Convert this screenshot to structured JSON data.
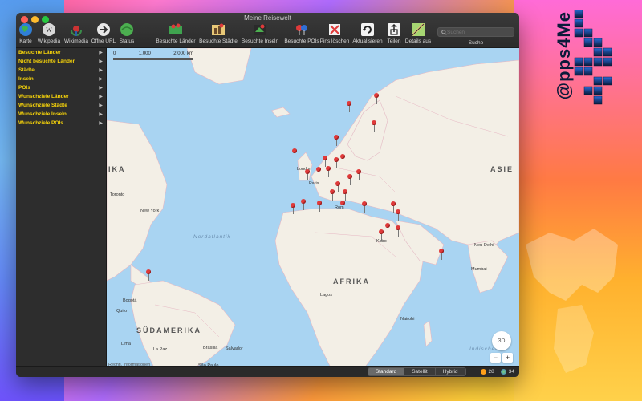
{
  "app": {
    "title": "Meine Reisewelt"
  },
  "toolbar": {
    "left": [
      {
        "label": "Karte",
        "icon": "globe-icon"
      },
      {
        "label": "Wikipedia",
        "icon": "wikipedia-icon"
      },
      {
        "label": "Wikimedia",
        "icon": "wikimedia-icon"
      },
      {
        "label": "Öffne URL",
        "icon": "forward-arrow-icon"
      },
      {
        "label": "Status",
        "icon": "status-globe-icon"
      }
    ],
    "right": [
      {
        "label": "Besuchte Länder",
        "icon": "visited-countries-icon"
      },
      {
        "label": "Besuchte Städte",
        "icon": "visited-cities-icon"
      },
      {
        "label": "Besuchte Inseln",
        "icon": "visited-islands-icon"
      },
      {
        "label": "Besuchte POIs",
        "icon": "visited-pois-icon"
      },
      {
        "label": "Pins löschen",
        "icon": "delete-pins-icon"
      },
      {
        "label": "Aktualisieren",
        "icon": "refresh-icon"
      },
      {
        "label": "Teilen",
        "icon": "share-icon"
      },
      {
        "label": "Details aus",
        "icon": "details-icon"
      }
    ]
  },
  "search": {
    "placeholder": "Suchen",
    "label": "Suche"
  },
  "sidebar": {
    "items": [
      {
        "label": "Besuchte Länder"
      },
      {
        "label": "Nicht besuchte Länder"
      },
      {
        "label": "Städte"
      },
      {
        "label": "Inseln"
      },
      {
        "label": "POIs"
      },
      {
        "label": "Wunschziele Länder"
      },
      {
        "label": "Wunschziele Städte"
      },
      {
        "label": "Wunschziele Inseln"
      },
      {
        "label": "Wunschziele POIs"
      }
    ]
  },
  "map": {
    "scale": {
      "zero": "0",
      "mid": "1.000",
      "max": "2.000 km"
    },
    "region_labels": {
      "europa": "IKA",
      "asien": "ASIE",
      "afrika": "AFRIKA",
      "suedamerika": "SÜDAMERIKA"
    },
    "ocean_labels": {
      "atlantik": "Nordatlantik",
      "indik": "Indischer Oz"
    },
    "cities": {
      "london": "London",
      "paris": "Paris",
      "rom": "Rom",
      "toronto": "Toronto",
      "new_york": "New York",
      "kairo": "Kairo",
      "lagos": "Lagos",
      "nairobi": "Nairobi",
      "mumbai": "Mumbai",
      "neu_delhi": "Neu-Delhi",
      "bogota": "Bogotá",
      "quito": "Quito",
      "lima": "Lima",
      "la_paz": "La Paz",
      "brasilia": "Brasília",
      "salvador": "Salvador",
      "sao_paulo": "São Paulo"
    },
    "legal": "Rechtl. Informationen",
    "btn_3d": "3D",
    "zoom_out": "−",
    "zoom_in": "+"
  },
  "statusbar": {
    "map_types": [
      "Standard",
      "Satellit",
      "Hybrid"
    ],
    "active": "Standard",
    "count_visited": "28",
    "count_total": "34"
  },
  "colors": {
    "sidebar_text": "#f5d20a",
    "pin": "#e03a3a",
    "ocean": "#a9d4f2",
    "land": "#f3efe6"
  },
  "watermark": "@pps4Me"
}
